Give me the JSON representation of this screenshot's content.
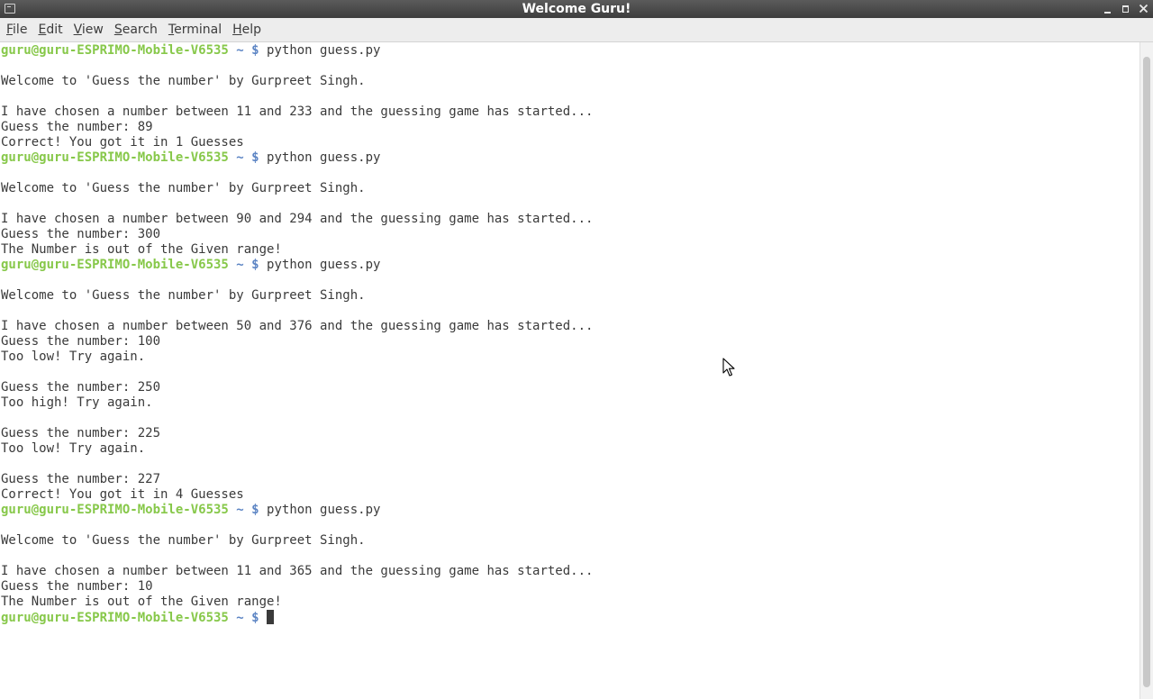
{
  "window": {
    "title": "Welcome Guru!"
  },
  "menu": {
    "items": [
      {
        "mnemonic": "F",
        "rest": "ile"
      },
      {
        "mnemonic": "E",
        "rest": "dit"
      },
      {
        "mnemonic": "V",
        "rest": "iew"
      },
      {
        "mnemonic": "S",
        "rest": "earch"
      },
      {
        "mnemonic": "T",
        "rest": "erminal"
      },
      {
        "mnemonic": "H",
        "rest": "elp"
      }
    ]
  },
  "prompt": {
    "user_host": "guru@guru-ESPRIMO-Mobile-V6535",
    "path": " ~ $ "
  },
  "terminal": {
    "lines": [
      {
        "type": "prompt",
        "cmd": "python guess.py"
      },
      {
        "type": "out",
        "text": ""
      },
      {
        "type": "out",
        "text": "Welcome to 'Guess the number' by Gurpreet Singh."
      },
      {
        "type": "out",
        "text": ""
      },
      {
        "type": "out",
        "text": "I have chosen a number between 11 and 233 and the guessing game has started..."
      },
      {
        "type": "out",
        "text": "Guess the number: 89"
      },
      {
        "type": "out",
        "text": "Correct! You got it in 1 Guesses"
      },
      {
        "type": "prompt",
        "cmd": "python guess.py"
      },
      {
        "type": "out",
        "text": ""
      },
      {
        "type": "out",
        "text": "Welcome to 'Guess the number' by Gurpreet Singh."
      },
      {
        "type": "out",
        "text": ""
      },
      {
        "type": "out",
        "text": "I have chosen a number between 90 and 294 and the guessing game has started..."
      },
      {
        "type": "out",
        "text": "Guess the number: 300"
      },
      {
        "type": "out",
        "text": "The Number is out of the Given range!"
      },
      {
        "type": "prompt",
        "cmd": "python guess.py"
      },
      {
        "type": "out",
        "text": ""
      },
      {
        "type": "out",
        "text": "Welcome to 'Guess the number' by Gurpreet Singh."
      },
      {
        "type": "out",
        "text": ""
      },
      {
        "type": "out",
        "text": "I have chosen a number between 50 and 376 and the guessing game has started..."
      },
      {
        "type": "out",
        "text": "Guess the number: 100"
      },
      {
        "type": "out",
        "text": "Too low! Try again."
      },
      {
        "type": "out",
        "text": ""
      },
      {
        "type": "out",
        "text": "Guess the number: 250"
      },
      {
        "type": "out",
        "text": "Too high! Try again."
      },
      {
        "type": "out",
        "text": ""
      },
      {
        "type": "out",
        "text": "Guess the number: 225"
      },
      {
        "type": "out",
        "text": "Too low! Try again."
      },
      {
        "type": "out",
        "text": ""
      },
      {
        "type": "out",
        "text": "Guess the number: 227"
      },
      {
        "type": "out",
        "text": "Correct! You got it in 4 Guesses"
      },
      {
        "type": "prompt",
        "cmd": "python guess.py"
      },
      {
        "type": "out",
        "text": ""
      },
      {
        "type": "out",
        "text": "Welcome to 'Guess the number' by Gurpreet Singh."
      },
      {
        "type": "out",
        "text": ""
      },
      {
        "type": "out",
        "text": "I have chosen a number between 11 and 365 and the guessing game has started..."
      },
      {
        "type": "out",
        "text": "Guess the number: 10"
      },
      {
        "type": "out",
        "text": "The Number is out of the Given range!"
      },
      {
        "type": "prompt",
        "cmd": "",
        "cursor": true
      }
    ]
  },
  "icons": {
    "app": "terminal-icon",
    "minimize": "minimize-icon",
    "maximize": "maximize-icon",
    "close": "close-icon",
    "pointer": "mouse-pointer-icon"
  },
  "colors": {
    "prompt_user": "#87c84a",
    "prompt_path": "#5d85c4",
    "text": "#3a3a3a",
    "titlebar": "#4a4a4a",
    "menubar": "#ededed"
  }
}
